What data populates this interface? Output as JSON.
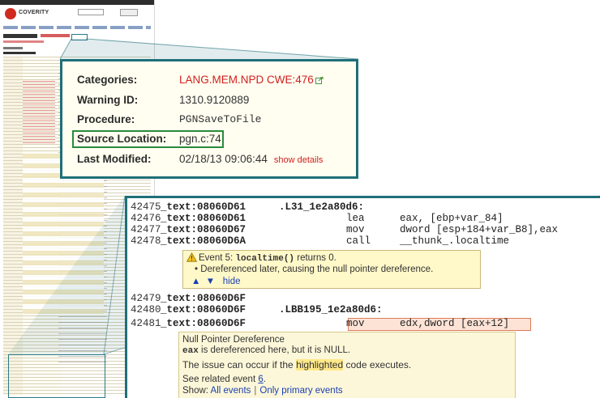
{
  "thumbnail": {
    "logo_text": "COVERITY"
  },
  "details": {
    "categories_label": "Categories:",
    "categories_value": "LANG.MEM.NPD CWE:476",
    "warning_id_label": "Warning ID:",
    "warning_id_value": "1310.9120889",
    "procedure_label": "Procedure:",
    "procedure_value": "PGNSaveToFile",
    "source_location_label": "Source Location:",
    "source_location_value": "pgn.c:74",
    "last_modified_label": "Last Modified:",
    "last_modified_value": "02/18/13 09:06:44",
    "show_details_link": "show details"
  },
  "code": {
    "lines": [
      {
        "num": "42475",
        "c1": "_text:08060D61",
        "c2": ".L31_1e2a80d6:",
        "c3": ""
      },
      {
        "num": "42476",
        "c1": "_text:08060D61",
        "c2": "lea",
        "c3": "eax, [ebp+var_84]"
      },
      {
        "num": "42477",
        "c1": "_text:08060D67",
        "c2": "mov",
        "c3": "dword [esp+184+var_B8],eax"
      },
      {
        "num": "42478",
        "c1": "_text:08060D6A",
        "c2": "call",
        "c3": "__thunk_.localtime"
      },
      {
        "num": "42479",
        "c1": "_text:08060D6F",
        "c2": "",
        "c3": ""
      },
      {
        "num": "42480",
        "c1": "_text:08060D6F",
        "c2": ".LBB195_1e2a80d6:",
        "c3": ""
      },
      {
        "num": "42481",
        "c1": "_text:08060D6F",
        "c2": "mov",
        "c3": "edx,dword [eax+12]"
      }
    ],
    "event5": {
      "prefix": "Event 5:",
      "func": "localtime()",
      "suffix": "returns 0.",
      "detail": "Dereferenced later, causing the null pointer dereference.",
      "hide_link": "hide"
    },
    "npd": {
      "title": "Null Pointer Dereference",
      "var": "eax",
      "desc": "is dereferenced here, but it is NULL.",
      "issue_pre": "The issue can occur if the",
      "issue_hl": "highlighted",
      "issue_post": "code executes.",
      "related_pre": "See related event",
      "related_num": "6",
      "show_label": "Show:",
      "all_events": "All events",
      "sep": "|",
      "only_primary": "Only primary events"
    }
  },
  "colors": {
    "frame": "#1f6f78",
    "red": "#d11f1f",
    "link": "#1a3fb3"
  }
}
